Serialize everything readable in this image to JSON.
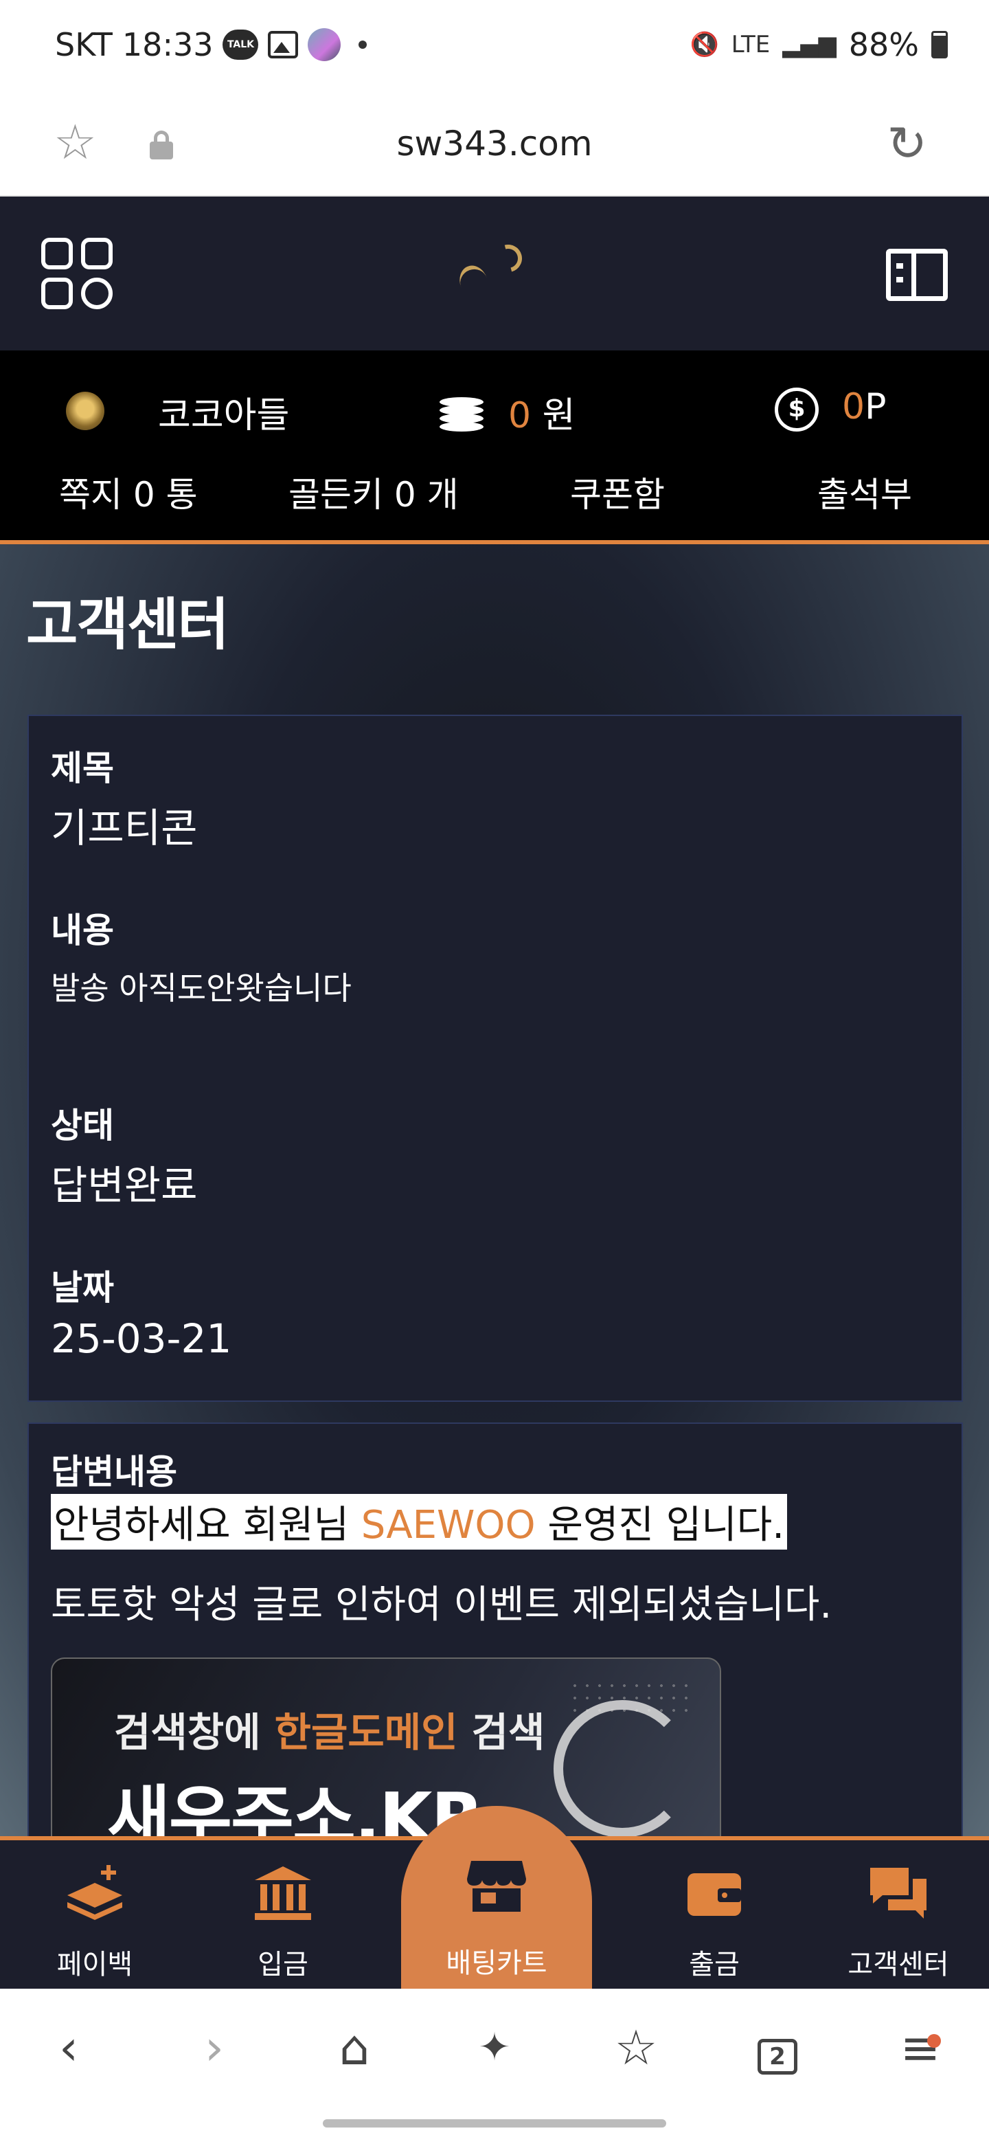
{
  "status_bar": {
    "carrier": "SKT",
    "time": "18:33",
    "talk_badge": "TALK",
    "network": "LTE",
    "battery": "88%"
  },
  "browser": {
    "url": "sw343.com",
    "tab_count": "2"
  },
  "user": {
    "name": "코코아들",
    "money_value": "0",
    "money_unit": "원",
    "points_value": "0",
    "points_unit": "P",
    "point_icon_symbol": "$"
  },
  "quick_links": [
    {
      "label": "쪽지 0 통"
    },
    {
      "label": "골든키 0 개"
    },
    {
      "label": "쿠폰함"
    },
    {
      "label": "출석부"
    }
  ],
  "page": {
    "title": "고객센터"
  },
  "inquiry": {
    "subject_label": "제목",
    "subject_value": "기프티콘",
    "content_label": "내용",
    "content_value": "발송  아직도안왓습니다",
    "status_label": "상태",
    "status_value": "답변완료",
    "date_label": "날짜",
    "date_value": "25-03-21"
  },
  "answer": {
    "label": "답변내용",
    "greeting_prefix": "안녕하세요 회원님 ",
    "greeting_brand": "SAEWOO",
    "greeting_suffix": " 운영진 입니다.",
    "body": "토토핫 악성 글로 인하여 이벤트 제외되셨습니다.",
    "banner_prefix": "검색창에 ",
    "banner_highlight": "한글도메인",
    "banner_suffix": " 검색",
    "banner_big": "새우주소.KR"
  },
  "bottom_nav": [
    {
      "label": "페이백",
      "icon": "payback-stack-icon"
    },
    {
      "label": "입금",
      "icon": "bank-icon"
    },
    {
      "label": "배팅카트",
      "icon": "store-icon"
    },
    {
      "label": "출금",
      "icon": "wallet-icon"
    },
    {
      "label": "고객센터",
      "icon": "chat-bubbles-icon"
    }
  ],
  "colors": {
    "accent": "#e0843f",
    "header_bg": "#1c1e2c",
    "card_bg": "#1c1f2e"
  }
}
